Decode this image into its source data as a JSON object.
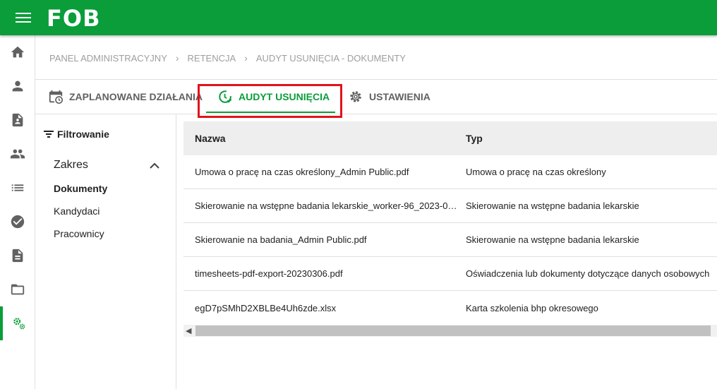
{
  "header": {
    "logo_text": "FOB"
  },
  "colors": {
    "brand": "#0a9d3a",
    "highlight": "#e0131b"
  },
  "sidenav": {
    "items": [
      {
        "icon": "home-icon"
      },
      {
        "icon": "person-icon"
      },
      {
        "icon": "document-person-icon"
      },
      {
        "icon": "people-icon"
      },
      {
        "icon": "list-icon"
      },
      {
        "icon": "check-circle-icon"
      },
      {
        "icon": "document-icon"
      },
      {
        "icon": "folder-open-icon"
      },
      {
        "icon": "settings-gears-icon",
        "active": true
      }
    ]
  },
  "breadcrumb": {
    "items": [
      "PANEL ADMINISTRACYJNY",
      "RETENCJA",
      "AUDYT USUNIĘCIA - DOKUMENTY"
    ],
    "separator": "›"
  },
  "tabs": [
    {
      "label": "ZAPLANOWANE DZIAŁANIA",
      "icon": "calendar-clock-icon"
    },
    {
      "label": "AUDYT USUNIĘCIA",
      "icon": "clock-check-icon",
      "active": true
    },
    {
      "label": "USTAWIENIA",
      "icon": "gear-icon"
    }
  ],
  "filter": {
    "title": "Filtrowanie",
    "section": "Zakres",
    "options": [
      "Dokumenty",
      "Kandydaci",
      "Pracownicy"
    ],
    "selected": "Dokumenty"
  },
  "table": {
    "columns": [
      "Nazwa",
      "Typ"
    ],
    "rows": [
      [
        "Umowa o pracę na czas określony_Admin Public.pdf",
        "Umowa o pracę na czas określony"
      ],
      [
        "Skierowanie na wstępne badania lekarskie_worker-96_2023-0…",
        "Skierowanie na wstępne badania lekarskie"
      ],
      [
        "Skierowanie na badania_Admin Public.pdf",
        "Skierowanie na wstępne badania lekarskie"
      ],
      [
        "timesheets-pdf-export-20230306.pdf",
        "Oświadczenia lub dokumenty dotyczące danych osobowych"
      ],
      [
        "egD7pSMhD2XBLBe4Uh6zde.xlsx",
        "Karta szkolenia bhp okresowego"
      ]
    ]
  }
}
